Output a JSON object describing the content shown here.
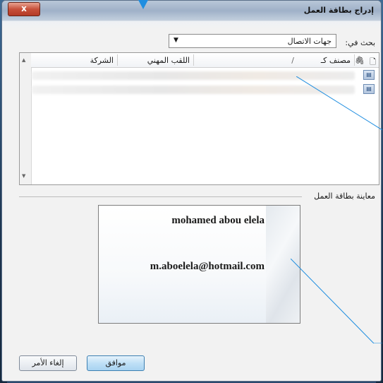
{
  "window": {
    "title": "إدراج بطاقة العمل",
    "close_label": "x"
  },
  "search": {
    "label": "بحث في:",
    "selected": "جهات الاتصال"
  },
  "list": {
    "columns": [
      {
        "label": "الشركة"
      },
      {
        "label": "اللقب المهني"
      },
      {
        "label": "مصنف كـ"
      }
    ],
    "sort_indicator": "/",
    "rows": [
      {
        "blurred": true
      },
      {
        "blurred": true
      }
    ]
  },
  "preview": {
    "label": "معاينة بطاقة العمل",
    "card": {
      "name": "mohamed abou elela",
      "email": "m.aboelela@hotmail.com"
    }
  },
  "buttons": {
    "ok": "موافق",
    "cancel": "إلغاء الأمر"
  },
  "colors": {
    "callout_line": "#1f8ee0",
    "ok_button": "#bfe0f6"
  }
}
